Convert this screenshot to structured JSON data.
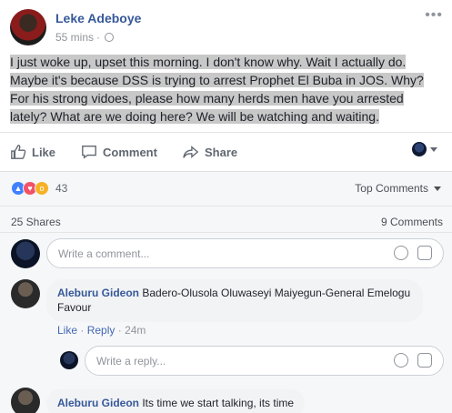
{
  "post": {
    "author": "Leke Adeboye",
    "time": "55 mins",
    "sep": "·",
    "text": "I just woke up, upset this morning. I don't know why. Wait I actually do. Maybe it's because DSS is trying to arrest Prophet El Buba in JOS. Why? For his strong vidoes, please how many herds men have you arrested lately? What are we doing here? We will be watching and waiting."
  },
  "actions": {
    "like": "Like",
    "comment": "Comment",
    "share": "Share"
  },
  "stats": {
    "reaction_count": "43",
    "top_comments": "Top Comments",
    "shares": "25 Shares",
    "comments": "9 Comments"
  },
  "composer": {
    "placeholder": "Write a comment..."
  },
  "comments": [
    {
      "author": "Aleburu Gideon",
      "text": "Badero-Olusola Oluwaseyi Maiyegun-General Emelogu Favour",
      "like": "Like",
      "reply": "Reply",
      "time": "24m"
    },
    {
      "author": "Aleburu Gideon",
      "text": "Its time we start talking, its time"
    }
  ],
  "reply_box": {
    "placeholder": "Write a reply..."
  },
  "colors": {
    "link": "#365899",
    "accent": "#4267b2",
    "bg_grey": "#f6f7f9"
  }
}
